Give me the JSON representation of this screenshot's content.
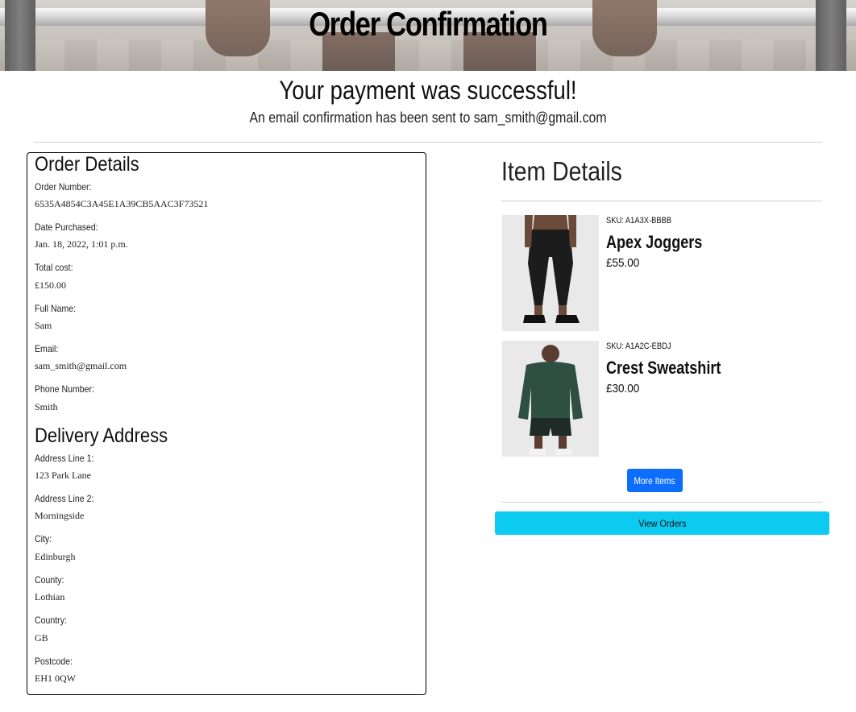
{
  "header": {
    "title": "Order Confirmation"
  },
  "confirmation": {
    "message": "Your payment was successful!",
    "email_note": "An email confirmation has been sent to sam_smith@gmail.com"
  },
  "order_details": {
    "heading": "Order Details",
    "fields": [
      {
        "label": "Order Number:",
        "value": "6535A4854C3A45E1A39CB5AAC3F73521"
      },
      {
        "label": "Date Purchased:",
        "value": "Jan. 18, 2022, 1:01 p.m."
      },
      {
        "label": "Total cost:",
        "value": "£150.00"
      },
      {
        "label": "Full Name:",
        "value": "Sam"
      },
      {
        "label": "Email:",
        "value": "sam_smith@gmail.com"
      },
      {
        "label": "Phone Number:",
        "value": "Smith"
      }
    ]
  },
  "delivery_address": {
    "heading": "Delivery Address",
    "fields": [
      {
        "label": "Address Line 1:",
        "value": "123 Park Lane"
      },
      {
        "label": "Address Line 2:",
        "value": "Morningside"
      },
      {
        "label": "City:",
        "value": "Edinburgh"
      },
      {
        "label": "County:",
        "value": "Lothian"
      },
      {
        "label": "Country:",
        "value": "GB"
      },
      {
        "label": "Postcode:",
        "value": "EH1 0QW"
      }
    ]
  },
  "item_details": {
    "heading": "Item Details",
    "items": [
      {
        "sku": "SKU: A1A3X-BBBB",
        "name": "Apex Joggers",
        "price": "£55.00",
        "image": "joggers-product-photo"
      },
      {
        "sku": "SKU: A1A2C-EBDJ",
        "name": "Crest Sweatshirt",
        "price": "£30.00",
        "image": "sweatshirt-product-photo"
      }
    ],
    "more_items_label": "More Items",
    "view_orders_label": "View Orders"
  },
  "colors": {
    "primary_button": "#0d6efd",
    "info_button": "#0dcaf0",
    "sweatshirt_green": "#2f4f42"
  }
}
